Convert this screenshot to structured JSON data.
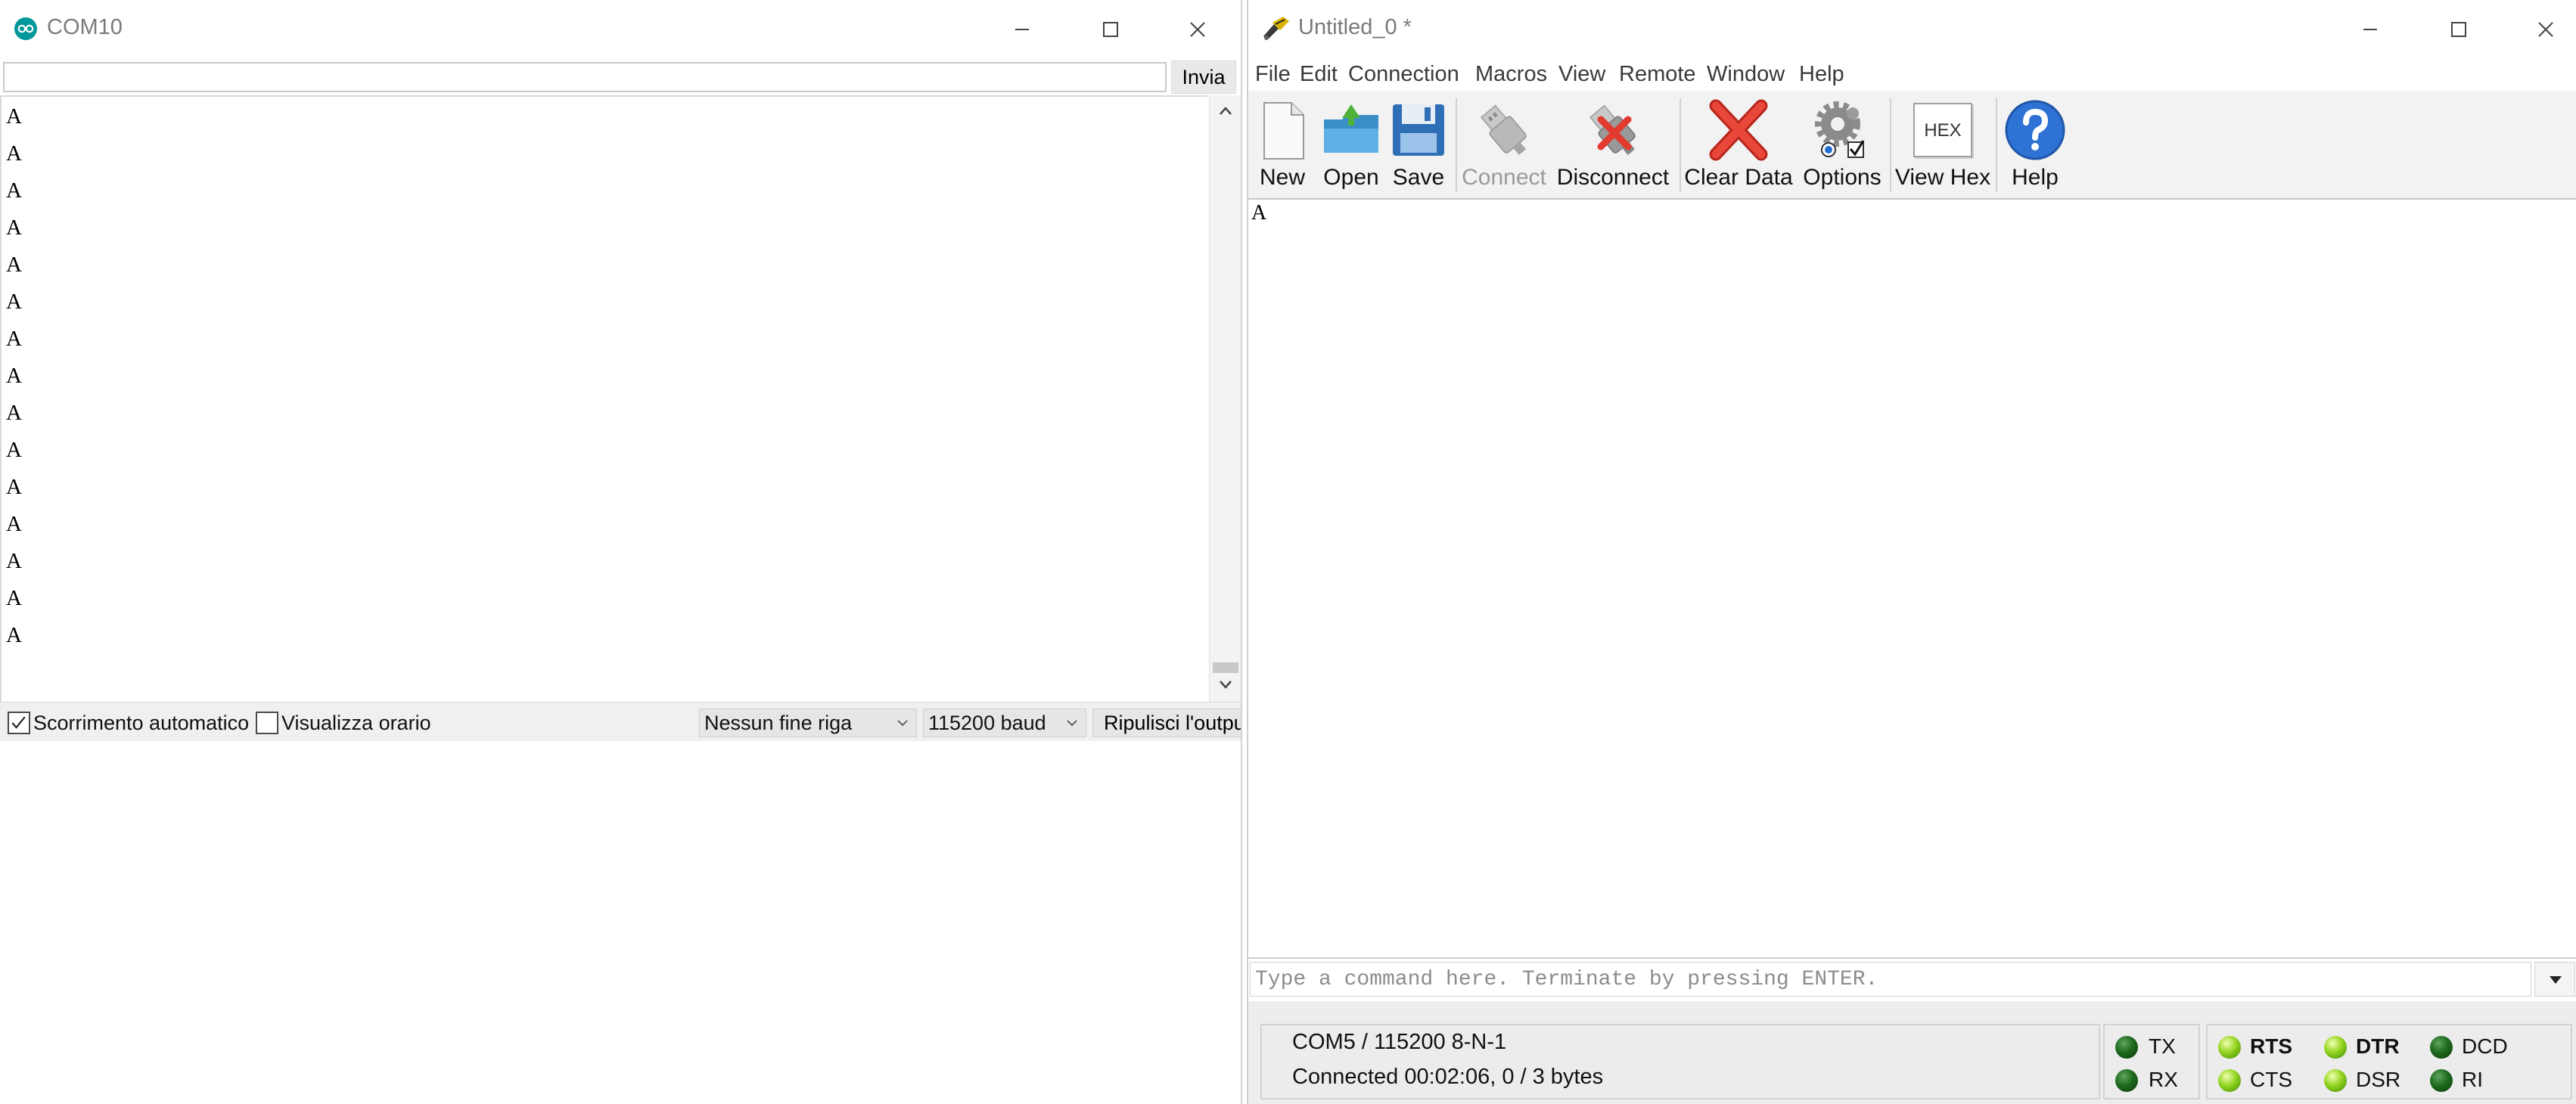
{
  "left_window": {
    "title": "COM10",
    "send_input_value": "",
    "send_button": "Invia",
    "output_lines": [
      "A",
      "A",
      "A",
      "A",
      "A",
      "A",
      "A",
      "A",
      "A",
      "A",
      "A",
      "A",
      "A",
      "A",
      "A"
    ],
    "bottom": {
      "autoscroll_label": "Scorrimento automatico",
      "autoscroll_checked": true,
      "timestamp_label": "Visualizza orario",
      "timestamp_checked": false,
      "line_ending": "Nessun fine riga",
      "baud": "115200 baud",
      "clear_output": "Ripulisci l'output"
    }
  },
  "right_window": {
    "title": "Untitled_0 *",
    "menu": [
      "File",
      "Edit",
      "Connection",
      "Macros",
      "View",
      "Remote",
      "Window",
      "Help"
    ],
    "toolbar": {
      "new": "New",
      "open": "Open",
      "save": "Save",
      "connect": "Connect",
      "disconnect": "Disconnect",
      "clear_data": "Clear Data",
      "options": "Options",
      "view_hex": "View Hex",
      "hex_icon_text": "HEX",
      "help": "Help"
    },
    "output_text": "A",
    "command_placeholder": "Type a command here. Terminate by pressing ENTER.",
    "status": {
      "port_settings": "COM5 / 115200 8-N-1",
      "connection_info": "Connected 00:02:06, 0 / 3 bytes",
      "signals": [
        {
          "label": "TX",
          "on": false
        },
        {
          "label": "RX",
          "on": false
        },
        {
          "label": "RTS",
          "on": true
        },
        {
          "label": "CTS",
          "on": true
        },
        {
          "label": "DTR",
          "on": true
        },
        {
          "label": "DSR",
          "on": true
        },
        {
          "label": "DCD",
          "on": false
        },
        {
          "label": "RI",
          "on": false
        }
      ]
    }
  },
  "colors": {
    "arduino_teal": "#00979c",
    "coolterm_toolbar": "#f2f2f2",
    "led_off": "#1e6a1e",
    "led_on": "#93d420",
    "help_blue": "#2f72d6",
    "clear_red": "#e23a2e"
  },
  "icons": {
    "left_title": "arduino-logo-icon",
    "right_title": "coolterm-logo-icon",
    "window_controls": [
      "minimize-icon",
      "maximize-icon",
      "close-icon"
    ]
  }
}
